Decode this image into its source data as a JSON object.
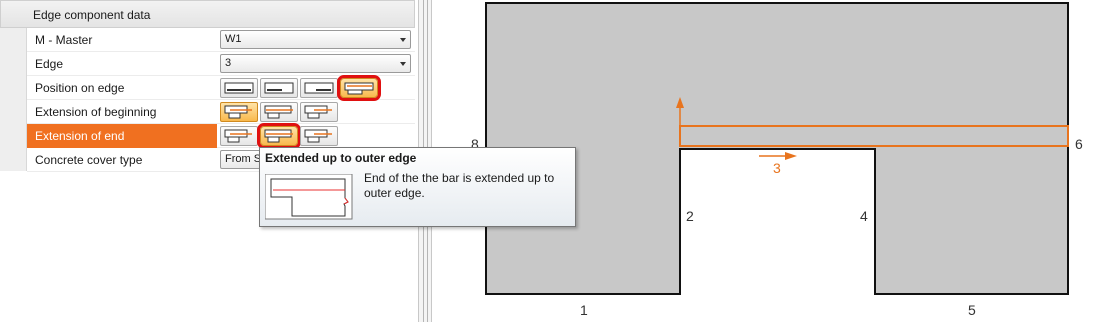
{
  "panel": {
    "header": "Edge component data",
    "rows": [
      {
        "label": "M - Master",
        "value": "W1"
      },
      {
        "label": "Edge",
        "value": "3"
      },
      {
        "label": "Position on edge"
      },
      {
        "label": "Extension of beginning"
      },
      {
        "label": "Extension of end"
      },
      {
        "label": "Concrete cover type",
        "value": "From S"
      }
    ]
  },
  "tooltip": {
    "title": "Extended up to outer edge",
    "text": "End of the the bar is extended up to outer edge."
  },
  "canvas": {
    "edge_labels": [
      "1",
      "2",
      "3",
      "4",
      "5",
      "6",
      "8"
    ],
    "accent_color": "#e8741e",
    "section_fill": "#c8c8c8"
  },
  "colors": {
    "highlight": "#f07020",
    "ring": "#e01010"
  }
}
